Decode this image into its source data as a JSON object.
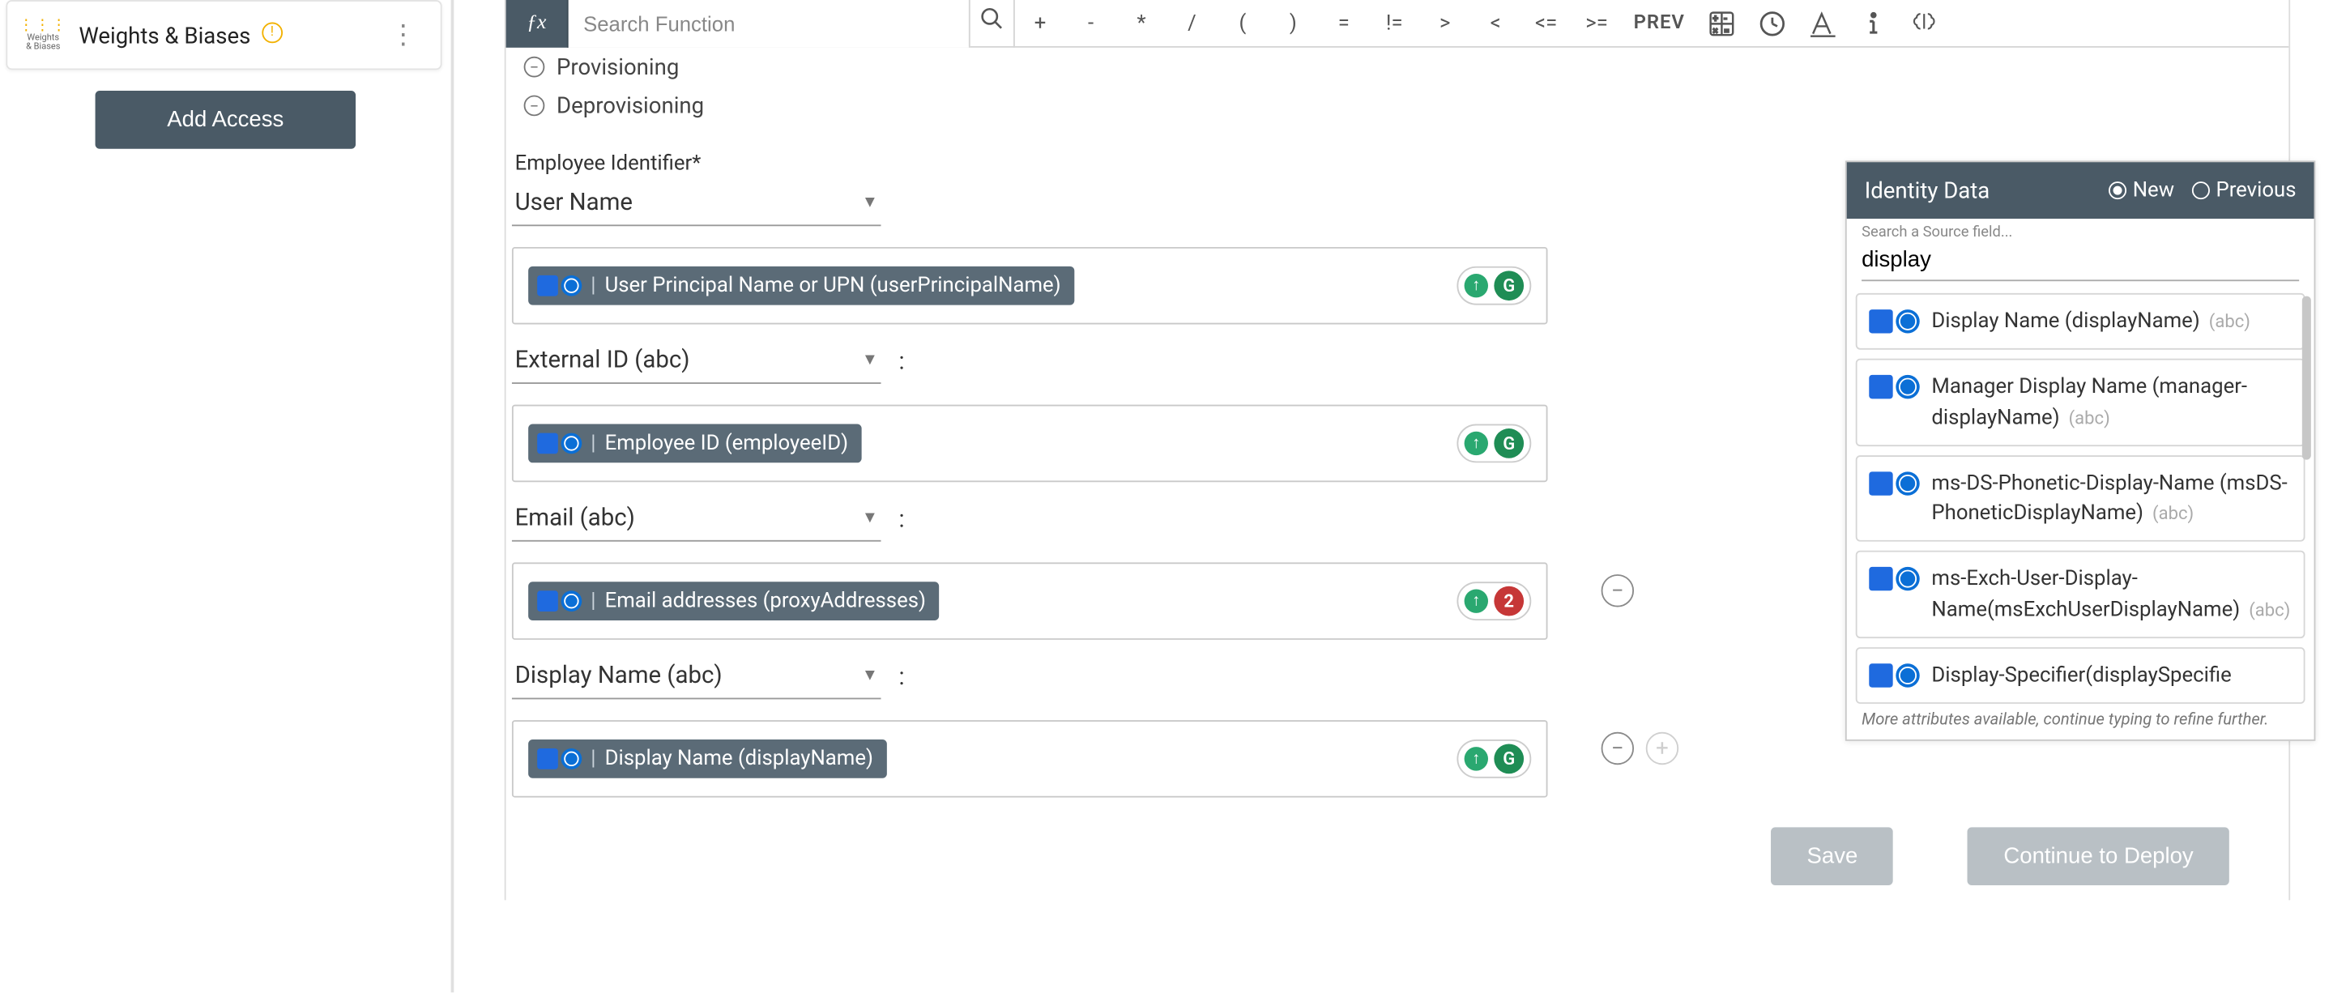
{
  "sidebar": {
    "app_name": "Weights & Biases",
    "logo_dots": "⋮⋮⋮",
    "logo_text_top": "Weights",
    "logo_text_bot": "& Biases",
    "add_access_label": "Add Access"
  },
  "fxbar": {
    "search_placeholder": "Search Function",
    "ops": [
      "+",
      "-",
      "*",
      "/",
      "(",
      ")",
      "=",
      "!=",
      ">",
      "<",
      "<=",
      ">="
    ],
    "prev_label": "PREV"
  },
  "sections": {
    "provisioning": "Provisioning",
    "deprovisioning": "Deprovisioning"
  },
  "fields": {
    "employee_identifier_label": "Employee Identifier*",
    "employee_identifier_select": "User Name",
    "employee_identifier_token": "User Principal Name or UPN (userPrincipalName)",
    "external_id_select": "External ID (abc)",
    "external_id_token": "Employee ID (employeeID)",
    "email_select": "Email (abc)",
    "email_token": "Email addresses (proxyAddresses)",
    "email_warn_count": "2",
    "display_name_select": "Display Name (abc)",
    "display_name_token": "Display Name (displayName)",
    "colon": ":"
  },
  "panel": {
    "title": "Identity Data",
    "radio_new": "New",
    "radio_previous": "Previous",
    "search_label": "Search a Source field...",
    "search_value": "display",
    "results": [
      {
        "name": "Display Name (displayName)",
        "type": "(abc)"
      },
      {
        "name": "Manager Display Name (manager-displayName)",
        "type": "(abc)"
      },
      {
        "name": "ms-DS-Phonetic-Display-Name (msDS-PhoneticDisplayName)",
        "type": "(abc)"
      },
      {
        "name": "ms-Exch-User-Display-Name(msExchUserDisplayName)",
        "type": "(abc)"
      },
      {
        "name": "Display-Specifier(displaySpecifie",
        "type": ""
      }
    ],
    "more_note": "More attributes available, continue typing to refine further."
  },
  "actions": {
    "save": "Save",
    "continue": "Continue to Deploy"
  },
  "glyphs": {
    "g": "G"
  }
}
